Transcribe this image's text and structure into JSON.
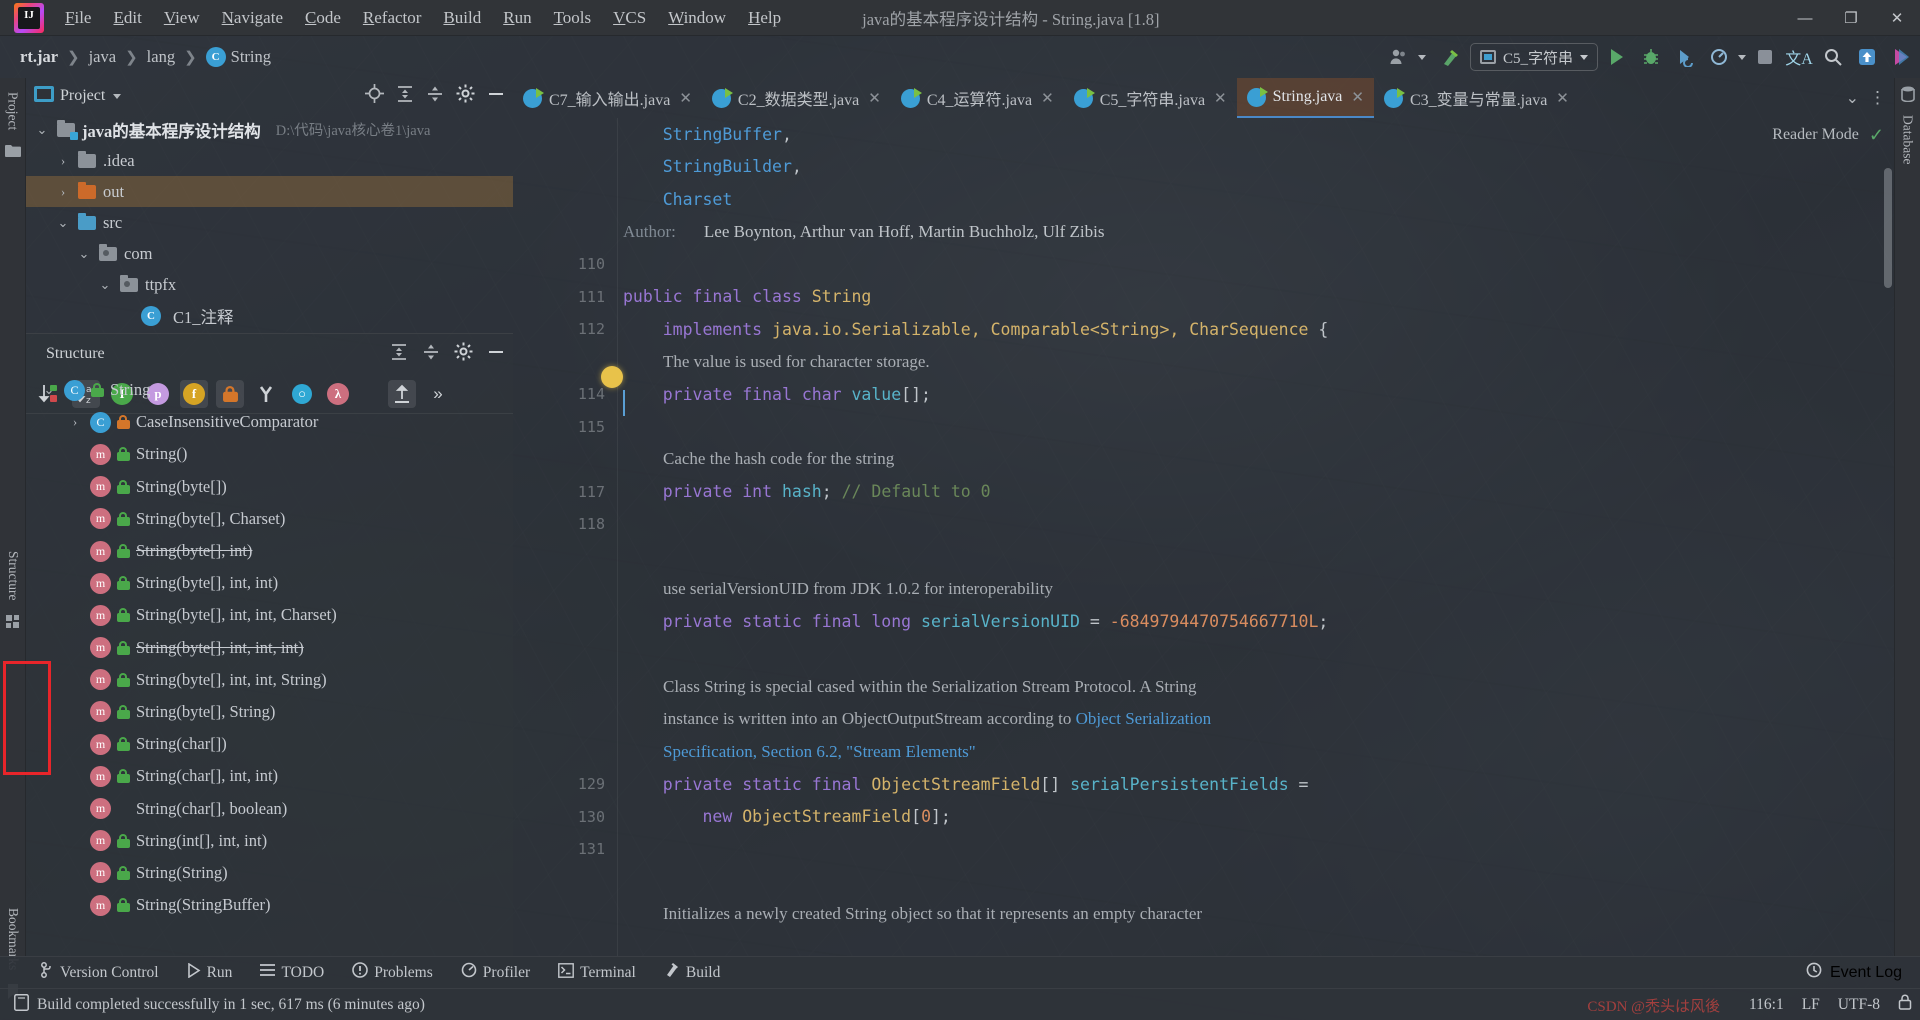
{
  "window": {
    "title": "java的基本程序设计结构 - String.java [1.8]",
    "minimize": "—",
    "maximize": "❐",
    "close": "✕"
  },
  "menu": {
    "items": [
      {
        "pre": "F",
        "label": "ile"
      },
      {
        "pre": "E",
        "label": "dit"
      },
      {
        "pre": "V",
        "label": "iew"
      },
      {
        "pre": "N",
        "label": "avigate"
      },
      {
        "pre": "C",
        "label": "ode"
      },
      {
        "pre": "R",
        "label": "efactor"
      },
      {
        "pre": "B",
        "label": "uild"
      },
      {
        "pre": "R",
        "label": "un"
      },
      {
        "pre": "T",
        "label": "ools"
      },
      {
        "pre": "V",
        "label": "CS"
      },
      {
        "pre": "W",
        "label": "indow"
      },
      {
        "pre": "H",
        "label": "elp"
      }
    ]
  },
  "breadcrumb": {
    "items": [
      "rt.jar",
      "java",
      "lang",
      "String"
    ],
    "class_icon_letter": "C",
    "separator": "❯"
  },
  "toolbar": {
    "run_config": "C5_字符串",
    "icons": [
      "user-group-icon",
      "hammer-icon",
      "run-icon",
      "debug-icon",
      "run-with-coverage-icon",
      "profile-icon",
      "stop-icon",
      "translate-icon",
      "search-icon",
      "update-icon",
      "ide-assistant-icon"
    ]
  },
  "left_stripe": {
    "tabs": [
      "Project",
      "Structure",
      "Bookmarks"
    ]
  },
  "right_stripe": {
    "tabs": [
      "Database"
    ]
  },
  "project_panel": {
    "title": "Project",
    "tree": [
      {
        "indent": 0,
        "arrow": "⌄",
        "icon": "module-folder",
        "label": "java的基本程序设计结构",
        "sub": "D:\\代码\\java核心卷1\\java",
        "bold": true,
        "selected": false
      },
      {
        "indent": 1,
        "arrow": "›",
        "icon": "folder-gray",
        "label": ".idea",
        "sub": "",
        "bold": false,
        "selected": false
      },
      {
        "indent": 1,
        "arrow": "›",
        "icon": "folder-orange",
        "label": "out",
        "sub": "",
        "bold": false,
        "selected": true
      },
      {
        "indent": 1,
        "arrow": "⌄",
        "icon": "folder-blue",
        "label": "src",
        "sub": "",
        "bold": false,
        "selected": false
      },
      {
        "indent": 2,
        "arrow": "⌄",
        "icon": "folder-pkg",
        "label": "com",
        "sub": "",
        "bold": false,
        "selected": false
      },
      {
        "indent": 3,
        "arrow": "⌄",
        "icon": "folder-pkg",
        "label": "ttpfx",
        "sub": "",
        "bold": false,
        "selected": false
      },
      {
        "indent": 4,
        "arrow": "",
        "icon": "java-file",
        "label": "C1_注释",
        "sub": "",
        "bold": false,
        "selected": false
      }
    ]
  },
  "structure_panel": {
    "title": "Structure",
    "toolbar_buttons": [
      "sort-by-visibility-icon",
      "sort-alphabetically-icon",
      "show-inherited-icon",
      "show-properties-icon",
      "show-fields-icon",
      "show-non-public-icon",
      "show-anonymous-icon",
      "show-interfaces-icon",
      "show-lambdas-icon",
      "expand-all-icon",
      "more-icon"
    ],
    "items": [
      {
        "indent": 0,
        "arrow": "⌄",
        "icon": "class",
        "lock": "green",
        "label": "String",
        "strike": false
      },
      {
        "indent": 1,
        "arrow": "›",
        "icon": "class",
        "lock": "orange",
        "label": "CaseInsensitiveComparator",
        "strike": false
      },
      {
        "indent": 1,
        "arrow": "",
        "icon": "method",
        "lock": "green",
        "label": "String()",
        "strike": false
      },
      {
        "indent": 1,
        "arrow": "",
        "icon": "method",
        "lock": "green",
        "label": "String(byte[])",
        "strike": false
      },
      {
        "indent": 1,
        "arrow": "",
        "icon": "method",
        "lock": "green",
        "label": "String(byte[], Charset)",
        "strike": false
      },
      {
        "indent": 1,
        "arrow": "",
        "icon": "method",
        "lock": "green",
        "label": "String(byte[], int)",
        "strike": true
      },
      {
        "indent": 1,
        "arrow": "",
        "icon": "method",
        "lock": "green",
        "label": "String(byte[], int, int)",
        "strike": false
      },
      {
        "indent": 1,
        "arrow": "",
        "icon": "method",
        "lock": "green",
        "label": "String(byte[], int, int, Charset)",
        "strike": false
      },
      {
        "indent": 1,
        "arrow": "",
        "icon": "method",
        "lock": "green",
        "label": "String(byte[], int, int, int)",
        "strike": true
      },
      {
        "indent": 1,
        "arrow": "",
        "icon": "method",
        "lock": "green",
        "label": "String(byte[], int, int, String)",
        "strike": false
      },
      {
        "indent": 1,
        "arrow": "",
        "icon": "method",
        "lock": "green",
        "label": "String(byte[], String)",
        "strike": false
      },
      {
        "indent": 1,
        "arrow": "",
        "icon": "method",
        "lock": "green",
        "label": "String(char[])",
        "strike": false
      },
      {
        "indent": 1,
        "arrow": "",
        "icon": "method",
        "lock": "green",
        "label": "String(char[], int, int)",
        "strike": false
      },
      {
        "indent": 1,
        "arrow": "",
        "icon": "method",
        "lock": "none",
        "label": "String(char[], boolean)",
        "strike": false
      },
      {
        "indent": 1,
        "arrow": "",
        "icon": "method",
        "lock": "green",
        "label": "String(int[], int, int)",
        "strike": false
      },
      {
        "indent": 1,
        "arrow": "",
        "icon": "method",
        "lock": "green",
        "label": "String(String)",
        "strike": false
      },
      {
        "indent": 1,
        "arrow": "",
        "icon": "method",
        "lock": "green",
        "label": "String(StringBuffer)",
        "strike": false
      }
    ]
  },
  "editor_tabs": {
    "tabs": [
      {
        "label": "C7_输入输出.java",
        "active": false
      },
      {
        "label": "C2_数据类型.java",
        "active": false
      },
      {
        "label": "C4_运算符.java",
        "active": false
      },
      {
        "label": "C5_字符串.java",
        "active": false
      },
      {
        "label": "String.java",
        "active": true
      },
      {
        "label": "C3_变量与常量.java",
        "active": false
      }
    ],
    "close_glyph": "✕",
    "overflow_glyph": "⌄",
    "more_glyph": "⋮"
  },
  "reader_mode": {
    "label": "Reader Mode",
    "check": "✓"
  },
  "editor": {
    "lines": [
      {
        "gutter": "",
        "parts": [
          {
            "t": "    ",
            "c": "pln"
          },
          {
            "t": "StringBuffer",
            "c": "lnk"
          },
          {
            "t": ",",
            "c": "pln"
          }
        ],
        "doc": false
      },
      {
        "gutter": "",
        "parts": [
          {
            "t": "    ",
            "c": "pln"
          },
          {
            "t": "StringBuilder",
            "c": "lnk"
          },
          {
            "t": ",",
            "c": "pln"
          }
        ],
        "doc": false
      },
      {
        "gutter": "",
        "parts": [
          {
            "t": "    ",
            "c": "pln"
          },
          {
            "t": "Charset",
            "c": "lnk"
          }
        ],
        "doc": false
      },
      {
        "gutter": "",
        "doc": true,
        "docparts": [
          {
            "t": "Author:",
            "c": "gry",
            "indent": 0
          },
          {
            "t": "Lee Boynton, Arthur van Hoff, Martin Buchholz, Ulf Zibis",
            "c": "pln",
            "indent": 1
          }
        ]
      },
      {
        "gutter": "110",
        "parts": [],
        "doc": false
      },
      {
        "gutter": "111",
        "parts": [
          {
            "t": "public final class ",
            "c": "kw"
          },
          {
            "t": "String",
            "c": "cls"
          }
        ],
        "doc": false
      },
      {
        "gutter": "112",
        "parts": [
          {
            "t": "    ",
            "c": "pln"
          },
          {
            "t": "implements ",
            "c": "kw"
          },
          {
            "t": "java.io.Serializable, Comparable<String>, CharSequence",
            "c": "cls"
          },
          {
            "t": " {",
            "c": "pln"
          }
        ],
        "doc": false
      },
      {
        "gutter": "",
        "doc": true,
        "docparts": [
          {
            "t": "The value is used for character storage.",
            "c": "doc",
            "indent": 2
          }
        ]
      },
      {
        "gutter": "114",
        "parts": [
          {
            "t": "    ",
            "c": "pln"
          },
          {
            "t": "private final char ",
            "c": "kw"
          },
          {
            "t": "value",
            "c": "fld"
          },
          {
            "t": "[];",
            "c": "pln"
          }
        ],
        "doc": false
      },
      {
        "gutter": "115",
        "parts": [],
        "doc": false
      },
      {
        "gutter": "",
        "doc": true,
        "docparts": [
          {
            "t": "Cache the hash code for the string",
            "c": "doc",
            "indent": 2
          }
        ]
      },
      {
        "gutter": "117",
        "parts": [
          {
            "t": "    ",
            "c": "pln"
          },
          {
            "t": "private int ",
            "c": "kw"
          },
          {
            "t": "hash",
            "c": "fld"
          },
          {
            "t": "; ",
            "c": "pln"
          },
          {
            "t": "// Default to 0",
            "c": "cmt"
          }
        ],
        "doc": false
      },
      {
        "gutter": "118",
        "parts": [],
        "doc": false
      },
      {
        "gutter": "",
        "parts": [],
        "doc": false
      },
      {
        "gutter": "",
        "doc": true,
        "docparts": [
          {
            "t": "use serialVersionUID from JDK 1.0.2 for interoperability",
            "c": "doc",
            "indent": 2
          }
        ]
      },
      {
        "gutter": "",
        "parts": [
          {
            "t": "    ",
            "c": "pln"
          },
          {
            "t": "private static final long ",
            "c": "kw"
          },
          {
            "t": "serialVersionUID",
            "c": "fld"
          },
          {
            "t": " = ",
            "c": "pln"
          },
          {
            "t": "-6849794470754667710L",
            "c": "num"
          },
          {
            "t": ";",
            "c": "pln"
          }
        ],
        "doc": false
      },
      {
        "gutter": "",
        "parts": [],
        "doc": false
      },
      {
        "gutter": "",
        "doc": true,
        "docparts": [
          {
            "t": "Class String is special cased within the Serialization Stream Protocol. A String",
            "c": "doc",
            "indent": 2
          }
        ]
      },
      {
        "gutter": "",
        "doc": true,
        "docparts": [
          {
            "t": "instance is written into an ObjectOutputStream according to ",
            "c": "doc",
            "indent": 2
          },
          {
            "t": "Object Serialization",
            "c": "lnk",
            "indent": 0
          }
        ]
      },
      {
        "gutter": "",
        "doc": true,
        "docparts": [
          {
            "t": "Specification, Section 6.2, \"Stream Elements\"",
            "c": "lnk",
            "indent": 2
          }
        ]
      },
      {
        "gutter": "129",
        "parts": [
          {
            "t": "    ",
            "c": "pln"
          },
          {
            "t": "private static final ",
            "c": "kw"
          },
          {
            "t": "ObjectStreamField",
            "c": "cls"
          },
          {
            "t": "[] ",
            "c": "pln"
          },
          {
            "t": "serialPersistentFields",
            "c": "fld"
          },
          {
            "t": " =",
            "c": "pln"
          }
        ],
        "doc": false
      },
      {
        "gutter": "130",
        "parts": [
          {
            "t": "        ",
            "c": "pln"
          },
          {
            "t": "new ",
            "c": "kw"
          },
          {
            "t": "ObjectStreamField",
            "c": "cls"
          },
          {
            "t": "[",
            "c": "pln"
          },
          {
            "t": "0",
            "c": "num"
          },
          {
            "t": "];",
            "c": "pln"
          }
        ],
        "doc": false
      },
      {
        "gutter": "131",
        "parts": [],
        "doc": false
      },
      {
        "gutter": "",
        "parts": [],
        "doc": false
      },
      {
        "gutter": "",
        "doc": true,
        "docparts": [
          {
            "t": "Initializes a newly created String object so that it represents an empty character",
            "c": "doc",
            "indent": 2
          }
        ]
      }
    ]
  },
  "bottom_bar": {
    "items": [
      {
        "icon": "version-control-icon",
        "label": "Version Control"
      },
      {
        "icon": "run-icon",
        "label": "Run"
      },
      {
        "icon": "todo-icon",
        "label": "TODO"
      },
      {
        "icon": "problems-icon",
        "label": "Problems"
      },
      {
        "icon": "profiler-icon",
        "label": "Profiler"
      },
      {
        "icon": "terminal-icon",
        "label": "Terminal"
      },
      {
        "icon": "build-icon",
        "label": "Build"
      }
    ],
    "event_log": "Event Log"
  },
  "status_bar": {
    "message": "Build completed successfully in 1 sec, 617 ms (6 minutes ago)",
    "caret": "116:1",
    "line_sep": "LF",
    "encoding": "UTF-8",
    "watermark": "CSDN @禿头は风後"
  },
  "colors": {
    "accent_blue": "#4a88c7",
    "green": "#59a869",
    "orange": "#cc6a2a",
    "annotation_red": "#e8252a"
  }
}
